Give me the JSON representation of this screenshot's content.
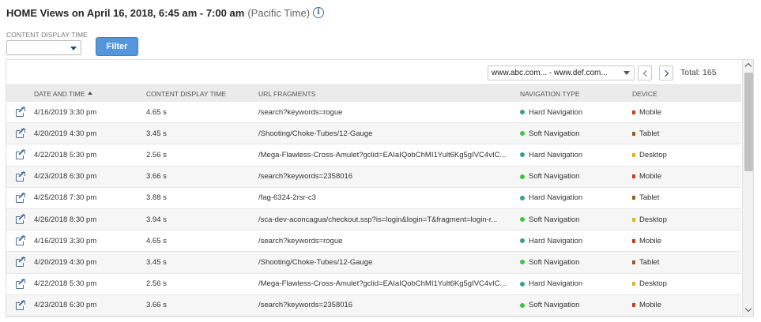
{
  "header": {
    "title": "HOME Views on April 16, 2018, 6:45 am - 7:00 am",
    "timezone": "(Pacific Time)",
    "info_icon": "info-circle-icon"
  },
  "filters": {
    "content_display_time_label": "CONTENT DISPLAY TIME",
    "content_display_time_value": "",
    "filter_button": "Filter"
  },
  "pager": {
    "range_value": "www.abc.com... - www.def.com...",
    "total": "Total: 165"
  },
  "table": {
    "columns": [
      "",
      "DATE AND TIME",
      "CONTENT DISPLAY TIME",
      "URL FRAGMENTS",
      "NAVIGATION TYPE",
      "DEVICE"
    ],
    "sort_column": "DATE AND TIME",
    "sort_direction": "ascending",
    "rows": [
      {
        "date": "4/16/2019 3:30 pm",
        "cdt": "4.65 s",
        "url": "/search?keywords=rogue",
        "nav": "Hard Navigation",
        "device": "Mobile"
      },
      {
        "date": "4/20/2019 4:30 pm",
        "cdt": "3.45 s",
        "url": "/Shooting/Choke-Tubes/12-Gauge",
        "nav": "Soft Navigation",
        "device": "Tablet"
      },
      {
        "date": "4/22/2018 5:30 pm",
        "cdt": "2.56 s",
        "url": "/Mega-Flawless-Cross-Amulet?gclid=EAIaIQobChMI1Yult6Kg5gIVC4vIC...",
        "nav": "Hard Navigation",
        "device": "Desktop"
      },
      {
        "date": "4/23/2018 6:30 pm",
        "cdt": "3.66 s",
        "url": "/search?keywords=2358016",
        "nav": "Soft Navigation",
        "device": "Mobile"
      },
      {
        "date": "4/25/2018 7:30 pm",
        "cdt": "3.88 s",
        "url": "/fag-6324-2rsr-c3",
        "nav": "Hard Navigation",
        "device": "Tablet"
      },
      {
        "date": "4/26/2018 8:30 pm",
        "cdt": "3.94 s",
        "url": "/sca-dev-aconcagua/checkout.ssp?is=login&login=T&fragment=login-r...",
        "nav": "Soft Navigation",
        "device": "Desktop"
      },
      {
        "date": "4/16/2019 3:30 pm",
        "cdt": "4.65 s",
        "url": "/search?keywords=rogue",
        "nav": "Hard Navigation",
        "device": "Mobile"
      },
      {
        "date": "4/20/2019 4:30 pm",
        "cdt": "3.45 s",
        "url": "/Shooting/Choke-Tubes/12-Gauge",
        "nav": "Soft Navigation",
        "device": "Tablet"
      },
      {
        "date": "4/22/2018 5:30 pm",
        "cdt": "2.56 s",
        "url": "/Mega-Flawless-Cross-Amulet?gclid=EAIaIQobChMI1Yult6Kg5gIVC4vIC...",
        "nav": "Hard Navigation",
        "device": "Desktop"
      },
      {
        "date": "4/23/2018 6:30 pm",
        "cdt": "3.66 s",
        "url": "/search?keywords=2358016",
        "nav": "Soft Navigation",
        "device": "Mobile"
      }
    ]
  },
  "colors": {
    "hard_navigation": "#3aa08a",
    "soft_navigation": "#44c241",
    "mobile": "#c1401f",
    "tablet": "#a05a1c",
    "desktop": "#e0b32a",
    "accent": "#5495dc"
  }
}
